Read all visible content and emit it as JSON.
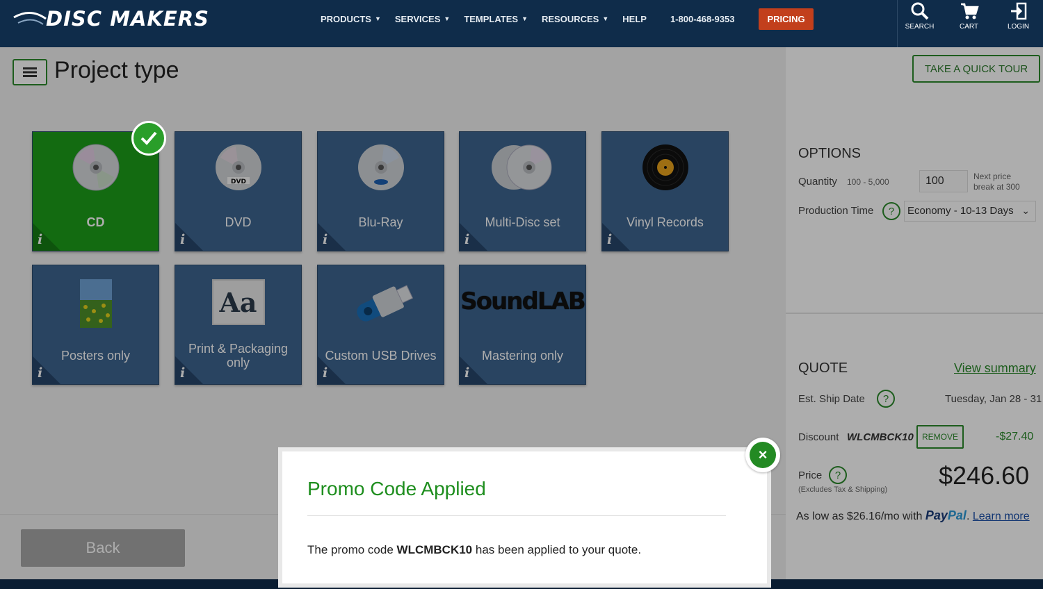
{
  "header": {
    "logo_text": "DISC MAKERS",
    "nav": [
      {
        "label": "PRODUCTS",
        "has_caret": true
      },
      {
        "label": "SERVICES",
        "has_caret": true
      },
      {
        "label": "TEMPLATES",
        "has_caret": true
      },
      {
        "label": "RESOURCES",
        "has_caret": true
      },
      {
        "label": "HELP",
        "has_caret": false
      }
    ],
    "phone": "1-800-468-9353",
    "pricing_label": "PRICING",
    "icons": [
      {
        "label": "SEARCH",
        "icon": "search-icon"
      },
      {
        "label": "CART",
        "icon": "cart-icon"
      },
      {
        "label": "LOGIN",
        "icon": "login-icon"
      }
    ]
  },
  "main": {
    "page_title": "Project type",
    "tiles": [
      {
        "label": "CD",
        "icon": "cd-icon",
        "selected": true
      },
      {
        "label": "DVD",
        "icon": "dvd-icon",
        "selected": false
      },
      {
        "label": "Blu-Ray",
        "icon": "bluray-icon",
        "selected": false
      },
      {
        "label": "Multi-Disc set",
        "icon": "multi-disc-icon",
        "selected": false
      },
      {
        "label": "Vinyl Records",
        "icon": "vinyl-icon",
        "selected": false
      },
      {
        "label": "Posters only",
        "icon": "poster-icon",
        "selected": false
      },
      {
        "label": "Print & Packaging only",
        "icon": "print-icon",
        "selected": false
      },
      {
        "label": "Custom USB Drives",
        "icon": "usb-icon",
        "selected": false
      },
      {
        "label": "Mastering only",
        "icon": "soundlab-logo",
        "selected": false
      }
    ],
    "tile_info_glyph": "i",
    "print_icon_text": "Aa",
    "soundlab_text": "SoundLAB",
    "back_label": "Back"
  },
  "sidebar": {
    "tour_label": "TAKE A QUICK TOUR",
    "options_title": "OPTIONS",
    "quantity_label": "Quantity",
    "quantity_range": "100 - 5,000",
    "quantity_value": "100",
    "price_break_line1": "Next price",
    "price_break_line2": "break at 300",
    "production_label": "Production Time",
    "production_value": "Economy - 10-13 Days",
    "quote_title": "QUOTE",
    "view_summary": "View summary",
    "ship_label": "Est. Ship Date",
    "ship_value": "Tuesday, Jan 28 - 31",
    "discount_label": "Discount",
    "discount_code": "WLCMBCK10",
    "remove_label": "REMOVE",
    "discount_value": "-$27.40",
    "price_label": "Price",
    "price_note": "(Excludes Tax & Shipping)",
    "price_value": "$246.60",
    "paypal_prefix": "As low as $26.16/mo with",
    "paypal_brand_1": "Pay",
    "paypal_brand_2": "Pal",
    "learn_more": "Learn more",
    "help_glyph": "?"
  },
  "modal": {
    "title": "Promo Code Applied",
    "body_prefix": "The promo code",
    "body_code": "WLCMBCK10",
    "body_suffix": "has been applied to your quote.",
    "close_glyph": "×"
  },
  "colors": {
    "header_bg": "#0f2c4a",
    "tile_bg": "#3d6590",
    "selected_tile": "#1d9e1a",
    "accent_green": "#2b8a2b",
    "pricing_btn": "#c23f1c"
  }
}
